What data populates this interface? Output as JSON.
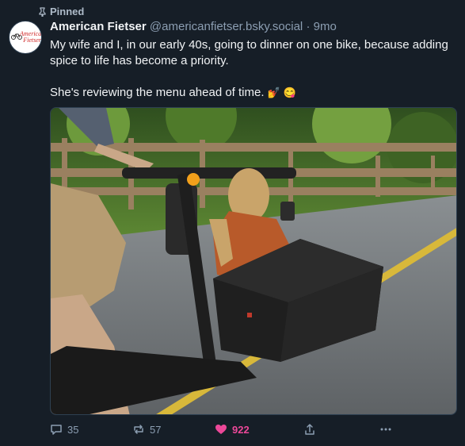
{
  "post": {
    "pinned_label": "Pinned",
    "author": {
      "display_name": "American Fietser",
      "handle": "@americanfietser.bsky.social",
      "avatar_text": "American Fietser"
    },
    "separator": "·",
    "timestamp": "9mo",
    "text": {
      "paragraph1": "My wife and I, in our early 40s, going to dinner on one bike, because adding spice to life has become a priority.",
      "paragraph2": "She's reviewing the menu ahead of time.",
      "emojis": [
        "💅",
        "😋"
      ]
    },
    "media_icon_names": [
      "photo-cargo-bike"
    ],
    "actions": {
      "replies": "35",
      "reposts": "57",
      "likes": "922",
      "liked": true
    }
  },
  "colors": {
    "background": "#161e27",
    "text": "#f1f3f5",
    "muted": "#8c9eb2",
    "like": "#ec4899"
  }
}
